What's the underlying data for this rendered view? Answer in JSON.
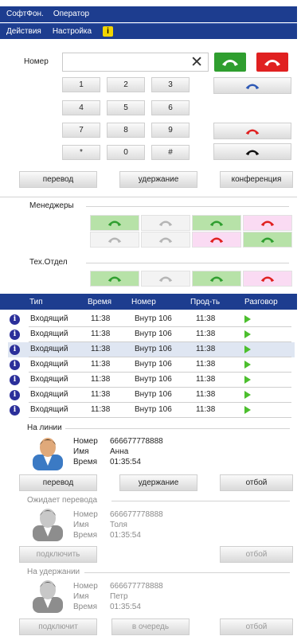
{
  "app": {
    "title": "СофтФон.",
    "subtitle": "Оператор"
  },
  "menu": {
    "actions": "Действия",
    "settings": "Настройка",
    "info_badge": "i"
  },
  "dialer": {
    "number_label": "Номер",
    "number_value": "",
    "clear_glyph": "✕",
    "keys": [
      "1",
      "2",
      "3",
      "4",
      "5",
      "6",
      "7",
      "8",
      "9",
      "*",
      "0",
      "#"
    ],
    "buttons": {
      "transfer": "перевод",
      "hold": "удержание",
      "conference": "конференция"
    }
  },
  "groups": [
    {
      "name": "Менеджеры",
      "lines": [
        [
          "green",
          "gray",
          "green",
          "pink"
        ],
        [
          "gray",
          "gray",
          "pink",
          "green"
        ]
      ]
    },
    {
      "name": "Тех.Отдел",
      "lines": [
        [
          "green",
          "gray",
          "green",
          "pink"
        ]
      ]
    }
  ],
  "calls_table": {
    "headers": [
      "Тип",
      "Время",
      "Номер",
      "Прод-ть",
      "Разговор"
    ],
    "rows": [
      {
        "type": "Входящий",
        "time": "11:38",
        "number": "Внутр 106",
        "duration": "11:38"
      },
      {
        "type": "Входящий",
        "time": "11:38",
        "number": "Внутр 106",
        "duration": "11:38"
      },
      {
        "type": "Входящий",
        "time": "11:38",
        "number": "Внутр 106",
        "duration": "11:38"
      },
      {
        "type": "Входящий",
        "time": "11:38",
        "number": "Внутр 106",
        "duration": "11:38"
      },
      {
        "type": "Входящий",
        "time": "11:38",
        "number": "Внутр 106",
        "duration": "11:38"
      },
      {
        "type": "Входящий",
        "time": "11:38",
        "number": "Внутр 106",
        "duration": "11:38"
      },
      {
        "type": "Входящий",
        "time": "11:38",
        "number": "Внутр 106",
        "duration": "11:38"
      }
    ],
    "selected_row": 2
  },
  "on_line": {
    "title": "На линии",
    "number_label": "Номер",
    "number": "666677778888",
    "name_label": "Имя",
    "name": "Анна",
    "time_label": "Время",
    "time": "01:35:54",
    "buttons": {
      "transfer": "перевод",
      "hold": "удержание",
      "hangup": "отбой"
    }
  },
  "awaiting_transfer": {
    "title": "Ожидает перевода",
    "number_label": "Номер",
    "number": "666677778888",
    "name_label": "Имя",
    "name": "Толя",
    "time_label": "Время",
    "time": "01:35:54",
    "buttons": {
      "connect": "подключить",
      "hangup": "отбой"
    }
  },
  "on_hold": {
    "title": "На удержании",
    "number_label": "Номер",
    "number": "666677778888",
    "name_label": "Имя",
    "name": "Петр",
    "time_label": "Время",
    "time": "01:35:54",
    "buttons": {
      "connect": "подключит",
      "queue": "в очередь",
      "hangup": "отбой"
    }
  },
  "colors": {
    "header_blue": "#1d3d8f",
    "green_line": "#b7e2a8",
    "pink_line": "#fadbf3",
    "call_green": "#2f9e2f",
    "hangup_red": "#e02020"
  }
}
